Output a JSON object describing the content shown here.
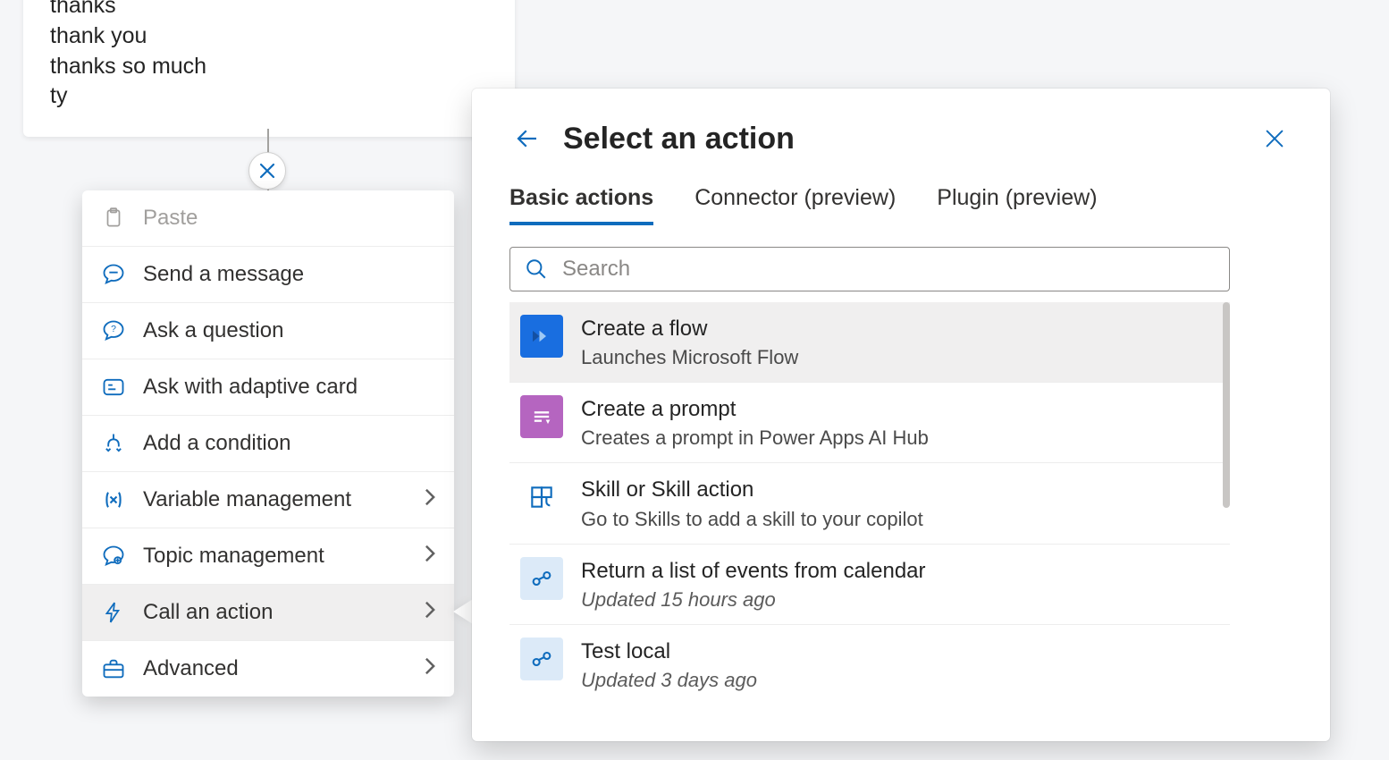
{
  "trigger_phrases": [
    "thanks",
    "thank you",
    "thanks so much",
    "ty"
  ],
  "context_menu": {
    "paste": "Paste",
    "items": [
      {
        "label": "Send a message",
        "has_children": false
      },
      {
        "label": "Ask a question",
        "has_children": false
      },
      {
        "label": "Ask with adaptive card",
        "has_children": false
      },
      {
        "label": "Add a condition",
        "has_children": false
      },
      {
        "label": "Variable management",
        "has_children": true
      },
      {
        "label": "Topic management",
        "has_children": true
      },
      {
        "label": "Call an action",
        "has_children": true,
        "selected": true
      },
      {
        "label": "Advanced",
        "has_children": true
      }
    ]
  },
  "panel": {
    "title": "Select an action",
    "tabs": [
      "Basic actions",
      "Connector (preview)",
      "Plugin (preview)"
    ],
    "active_tab": 0,
    "search_placeholder": "Search",
    "actions": [
      {
        "title": "Create a flow",
        "subtitle": "Launches Microsoft Flow",
        "icon": "flow",
        "highlighted": true
      },
      {
        "title": "Create a prompt",
        "subtitle": "Creates a prompt in Power Apps AI Hub",
        "icon": "prompt"
      },
      {
        "title": "Skill or Skill action",
        "subtitle": "Go to Skills to add a skill to your copilot",
        "icon": "skill"
      },
      {
        "title": "Return a list of events from calendar",
        "subtitle": "Updated 15 hours ago",
        "icon": "flow-light",
        "subitalic": true
      },
      {
        "title": "Test local",
        "subtitle": "Updated 3 days ago",
        "icon": "flow-light",
        "subitalic": true
      }
    ]
  }
}
